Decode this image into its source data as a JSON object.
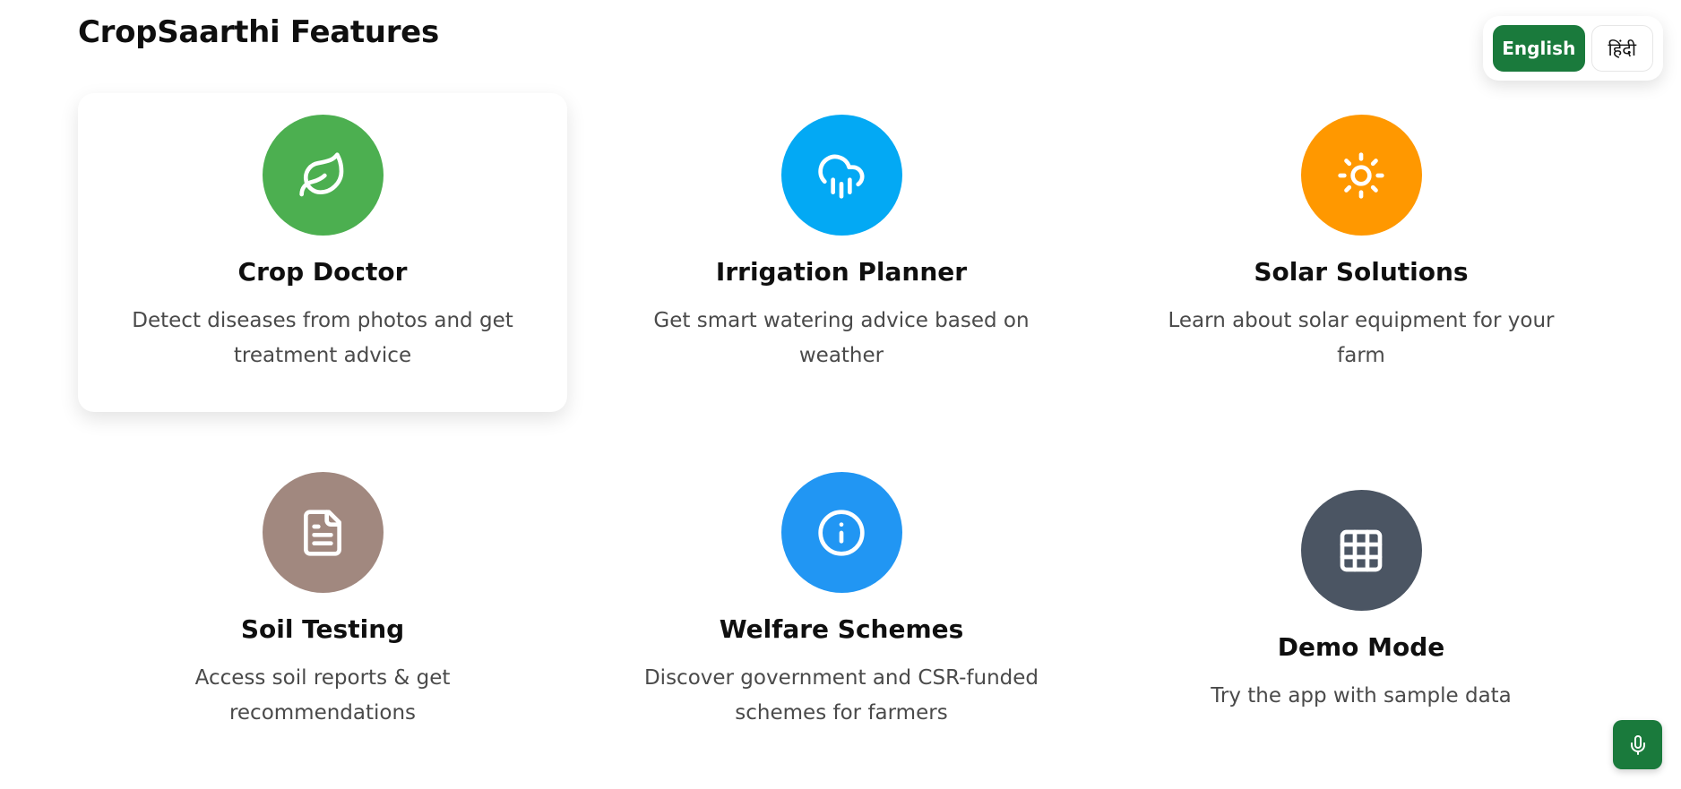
{
  "page": {
    "title": "CropSaarthi Features"
  },
  "language": {
    "options": [
      {
        "label": "English",
        "active": true
      },
      {
        "label": "हिंदी",
        "active": false
      }
    ]
  },
  "features": [
    {
      "title": "Crop Doctor",
      "description": "Detect diseases from photos and get treatment advice",
      "icon": "leaf-icon",
      "color": "#4caf50"
    },
    {
      "title": "Irrigation Planner",
      "description": "Get smart watering advice based on weather",
      "icon": "cloud-rain-icon",
      "color": "#03a9f4"
    },
    {
      "title": "Solar Solutions",
      "description": "Learn about solar equipment for your farm",
      "icon": "sun-icon",
      "color": "#ff9800"
    },
    {
      "title": "Soil Testing",
      "description": "Access soil reports & get recommendations",
      "icon": "document-icon",
      "color": "#a1887f"
    },
    {
      "title": "Welfare Schemes",
      "description": "Discover government and CSR-funded schemes for farmers",
      "icon": "info-icon",
      "color": "#2196f3"
    },
    {
      "title": "Demo Mode",
      "description": "Try the app with sample data",
      "icon": "grid-icon",
      "color": "#4b5563"
    }
  ],
  "voice": {
    "icon": "microphone-icon",
    "color": "#1a7a3c"
  }
}
